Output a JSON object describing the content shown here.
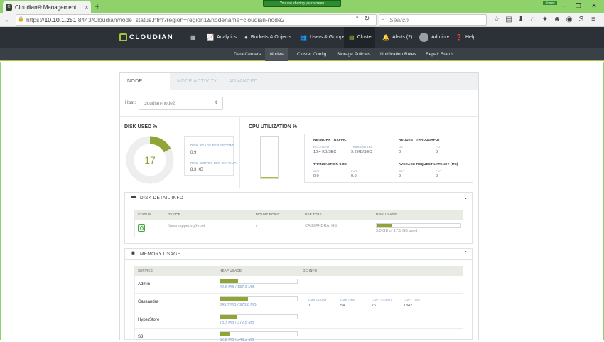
{
  "browser": {
    "tab_title": "Cloudian® Management ...",
    "tab_close": "×",
    "new_tab": "+",
    "sharing_banner": "You are sharing your screen",
    "shared_badge": "Shared",
    "url_host": "10.10.1.251",
    "url_rest": ":8443/Cloudian/node_status.htm?region=region1&nodename=cloudian-node2",
    "url_prefix": "https://",
    "search_placeholder": "Search"
  },
  "app": {
    "logo_text": "CLOUDIAN",
    "nav": {
      "analytics": "Analytics",
      "buckets": "Buckets & Objects",
      "users": "Users & Groups",
      "cluster": "Cluster",
      "alerts": "Alerts (2)",
      "admin": "Admin",
      "help": "Help"
    },
    "subnav": {
      "data_centers": "Data Centers",
      "nodes": "Nodes",
      "cluster_config": "Cluster Config",
      "storage_policies": "Storage Policies",
      "notification_rules": "Notification Rules",
      "repair_status": "Repair Status"
    }
  },
  "panel": {
    "tabs": {
      "node_status": "NODE STATUS",
      "node_activity": "NODE ACTIVITY",
      "advanced": "ADVANCED"
    },
    "host_label": "Host:",
    "host_value": "cloudian-node2",
    "disk_used": {
      "title": "DISK USED %",
      "percent": 17,
      "percent_text": "17",
      "reads_label": "DISK READS PER SECOND",
      "reads_value": "0.9",
      "writes_label": "DISK WRITES PER SECOND",
      "writes_value": "8.3 KB"
    },
    "cpu": {
      "title": "CPU UTILIZATION %",
      "percent": 3
    },
    "network": {
      "traffic_title": "NETWORK TRAFFIC",
      "received_label": "RECEIVED",
      "received_value": "10.4 KB/SEC",
      "transmitted_label": "TRANSMITTED",
      "transmitted_value": "9.2 KB/SEC",
      "req_title": "REQUEST THROUGHPUT",
      "req_get_label": "GET",
      "req_get_value": "0",
      "req_put_label": "PUT",
      "req_put_value": "0",
      "tx_title": "TRANSACTION SIZE",
      "tx_get_label": "GET",
      "tx_get_value": "0.0",
      "tx_put_label": "PUT",
      "tx_put_value": "0.0",
      "lat_title": "AVERAGE REQUEST LATENCY (MS)",
      "lat_get_label": "GET",
      "lat_get_value": "0",
      "lat_put_label": "PUT",
      "lat_put_value": "0"
    },
    "disk_detail": {
      "title": "DISK DETAIL INFO",
      "columns": {
        "status": "STATUS",
        "device": "DEVICE",
        "mount": "MOUNT POINT",
        "use_type": "USE TYPE",
        "disk_usage": "DISK USAGE"
      },
      "row": {
        "device": "/dev/mapper/vg0-root",
        "mount": "/",
        "use_type": "CASSANDRA, HS",
        "usage_text": "3.0 GB of 17.1 GB used",
        "usage_fraction": 0.18
      }
    },
    "memory": {
      "title": "MEMORY USAGE",
      "columns": {
        "service": "SERVICE",
        "heap": "HEAP USAGE",
        "gc": "GC INFO"
      },
      "rows": [
        {
          "service": "Admin",
          "heap_text": "42.6 MB / 187.3 MB",
          "fraction": 0.23
        },
        {
          "service": "Cassandra",
          "heap_text": "349.7 MB / 973.8 MB",
          "fraction": 0.36,
          "gc": {
            "cms_count_label": "CMS COUNT",
            "cms_count": "1",
            "cms_time_label": "CMS TIME",
            "cms_time": "54",
            "copy_count_label": "COPY COUNT",
            "copy_count": "76",
            "copy_time_label": "COPY TIME",
            "copy_time": "1842"
          }
        },
        {
          "service": "HyperStore",
          "heap_text": "78.7 MB / 372.5 MB",
          "fraction": 0.21
        },
        {
          "service": "S3",
          "heap_text": "32.8 MB / 243.2 MB",
          "fraction": 0.13
        }
      ]
    }
  }
}
